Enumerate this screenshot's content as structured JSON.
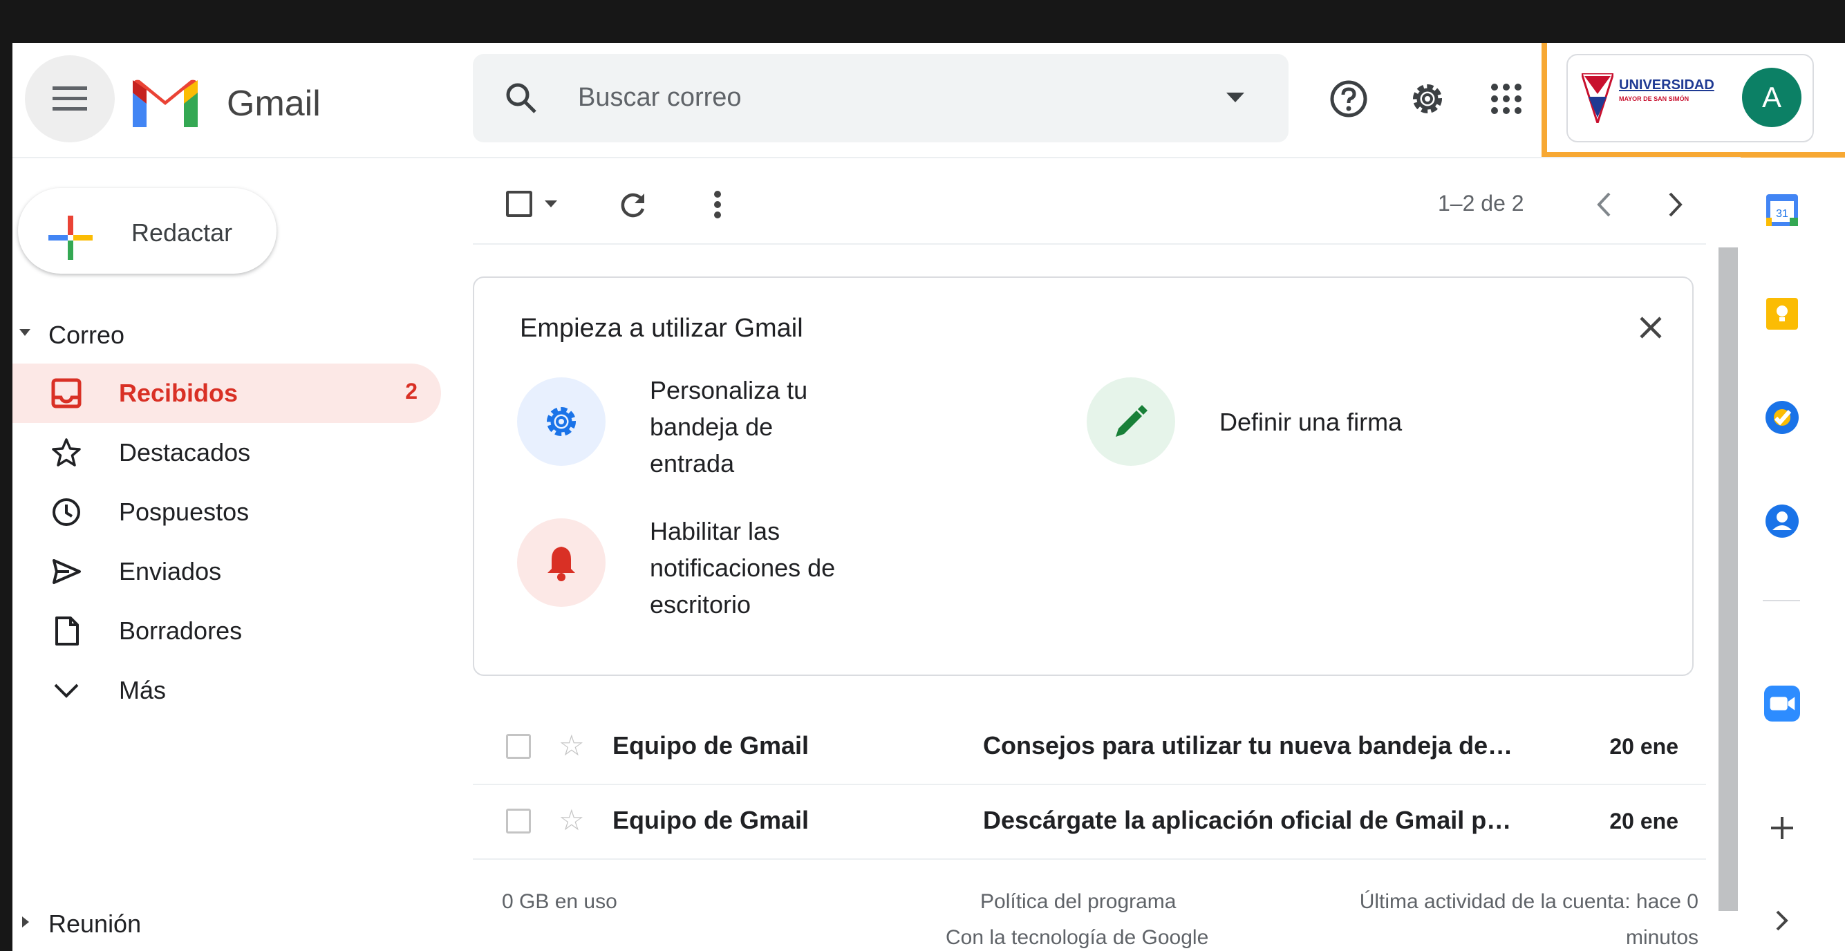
{
  "header": {
    "app_name": "Gmail",
    "search_placeholder": "Buscar correo",
    "account_org": "UNIVERSIDAD",
    "account_org_sub": "MAYOR DE SAN SIMÓN",
    "avatar_letter": "A"
  },
  "sidebar": {
    "compose_label": "Redactar",
    "section_mail": "Correo",
    "items": [
      {
        "label": "Recibidos",
        "count": "2",
        "icon": "inbox-icon"
      },
      {
        "label": "Destacados",
        "icon": "star-icon"
      },
      {
        "label": "Pospuestos",
        "icon": "clock-icon"
      },
      {
        "label": "Enviados",
        "icon": "send-icon"
      },
      {
        "label": "Borradores",
        "icon": "draft-icon"
      },
      {
        "label": "Más",
        "icon": "chevron-down-icon"
      }
    ],
    "section_meet": "Reunión"
  },
  "toolbar": {
    "pagination": "1–2 de 2"
  },
  "welcome_card": {
    "title": "Empieza a utilizar Gmail",
    "tasks": [
      {
        "label": "Personaliza tu bandeja de entrada",
        "icon": "gear-icon"
      },
      {
        "label": "Definir una firma",
        "icon": "pen-icon"
      },
      {
        "label": "Habilitar las notificaciones de escritorio",
        "icon": "bell-icon"
      }
    ]
  },
  "emails": [
    {
      "sender": "Equipo de Gmail",
      "subject": "Consejos para utilizar tu nueva bandeja de…",
      "date": "20 ene"
    },
    {
      "sender": "Equipo de Gmail",
      "subject": "Descárgate la aplicación oficial de Gmail p…",
      "date": "20 ene"
    }
  ],
  "footer": {
    "storage": "0 GB en uso",
    "policy": "Política del programa",
    "powered": "Con la tecnología de Google",
    "activity_line1": "Última actividad de la cuenta: hace 0",
    "activity_line2": "minutos"
  },
  "colors": {
    "accent_red": "#d93025",
    "avatar": "#0c8065",
    "highlight": "#f7a833"
  }
}
